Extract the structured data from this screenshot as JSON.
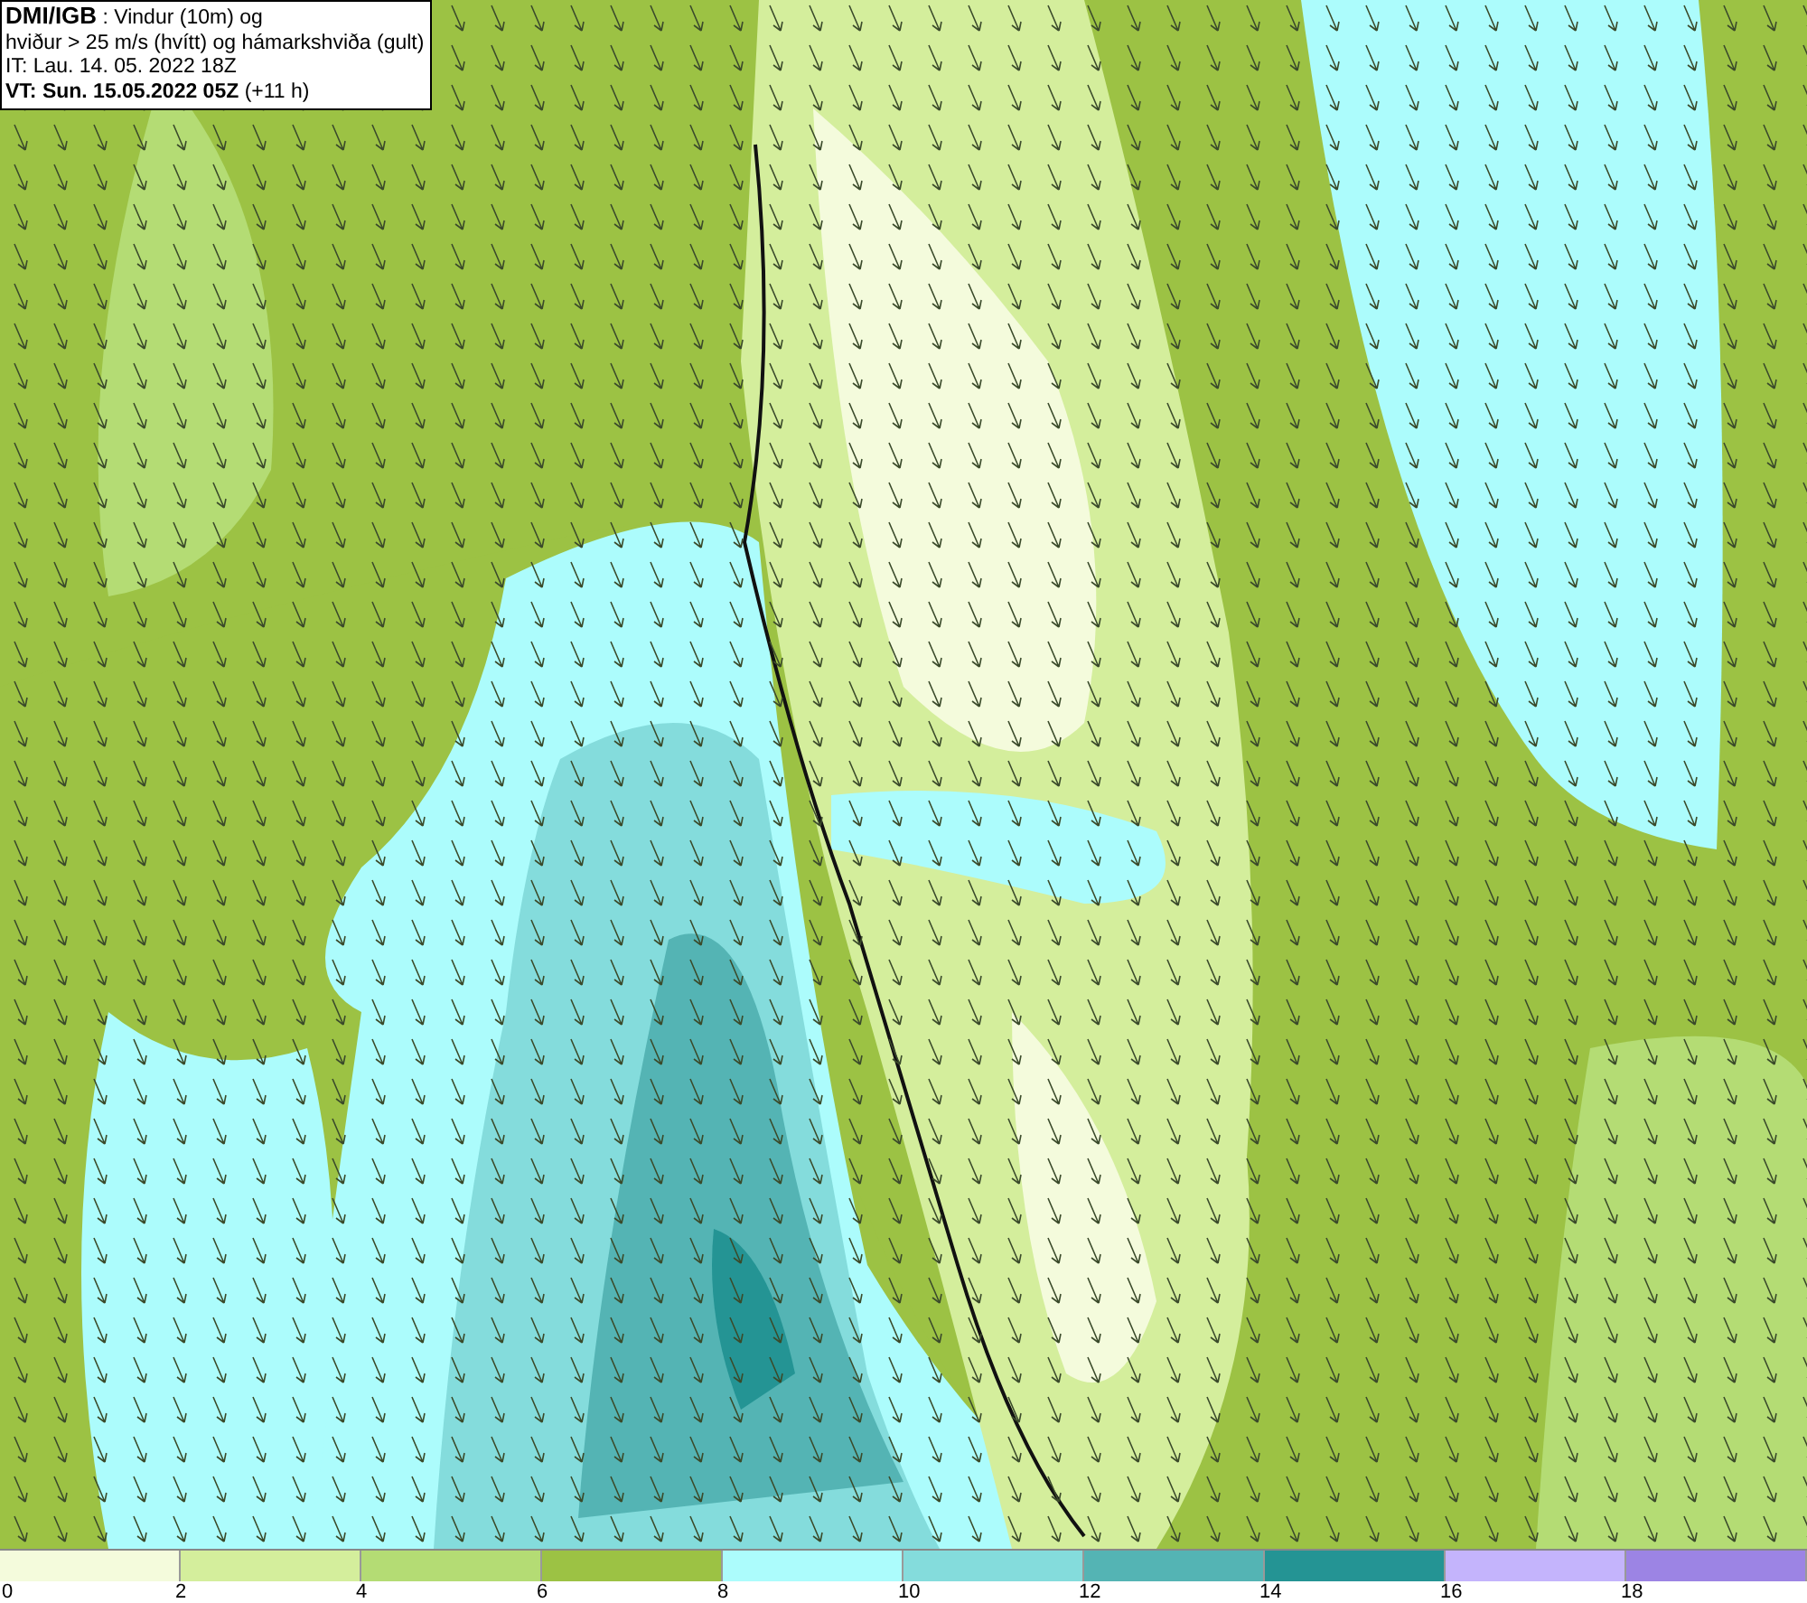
{
  "header": {
    "source": "DMI/IGB",
    "title_rest": " : Vindur (10m) og",
    "subtitle": "hviður > 25 m/s (hvítt) og hámarkshviða (gult)",
    "initial_time": "IT: Lau. 14. 05. 2022 18Z",
    "valid_time": "VT: Sun. 15.05.2022 05Z",
    "lead": " (+11 h)"
  },
  "legend": [
    {
      "color": "#f4fbdc",
      "label": "0"
    },
    {
      "color": "#d4ee9c",
      "label": "2"
    },
    {
      "color": "#b4dc74",
      "label": "4"
    },
    {
      "color": "#9cc244",
      "label": "6"
    },
    {
      "color": "#acfcfc",
      "label": "8"
    },
    {
      "color": "#84dcdc",
      "label": "10"
    },
    {
      "color": "#54b4b4",
      "label": "12"
    },
    {
      "color": "#249494",
      "label": "14"
    },
    {
      "color": "#c4b4fc",
      "label": "16"
    },
    {
      "color": "#9c84e4",
      "label": "18"
    }
  ]
}
